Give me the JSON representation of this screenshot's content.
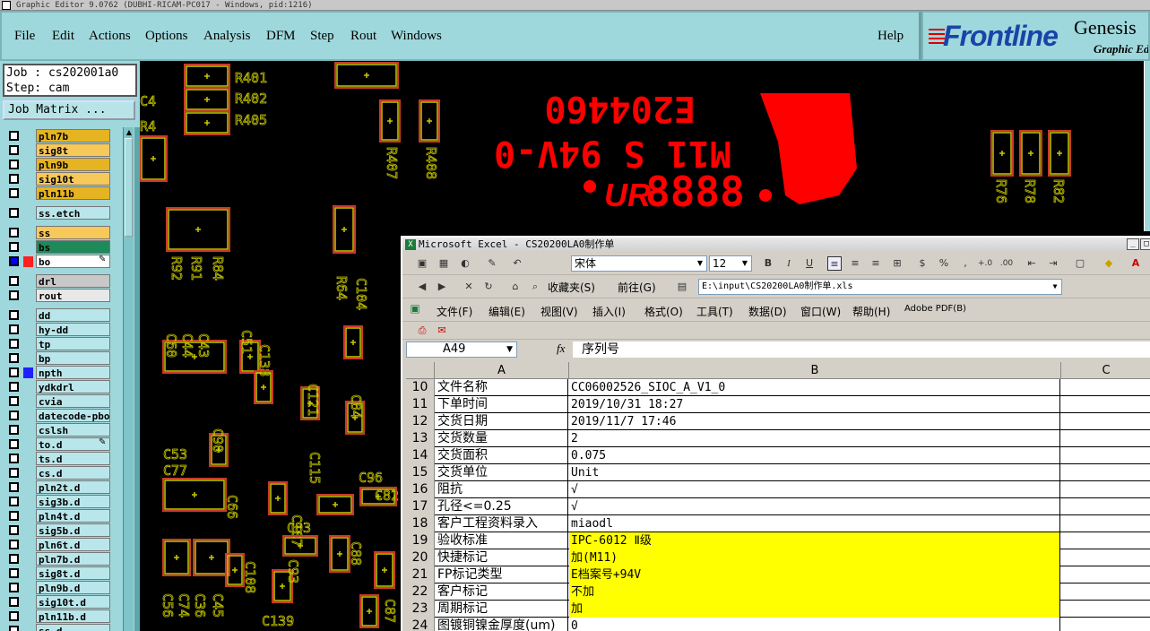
{
  "window": {
    "title": "Graphic Editor 9.0762 (DUBHI-RICAM-PC017 - Windows, pid:1216)"
  },
  "menu": [
    {
      "label": "File"
    },
    {
      "label": "Edit"
    },
    {
      "label": "Actions"
    },
    {
      "label": "Options"
    },
    {
      "label": "Analysis"
    },
    {
      "label": "DFM"
    },
    {
      "label": "Step"
    },
    {
      "label": "Rout"
    },
    {
      "label": "Windows"
    },
    {
      "label": "Help"
    }
  ],
  "logo": {
    "brand": "Frontline",
    "product": "Genesis",
    "subtitle": "Graphic Ed"
  },
  "job": {
    "job_line": "Job : cs202001a0",
    "step_line": "Step: cam",
    "matrix_button": "Job Matrix ..."
  },
  "layers": [
    {
      "name": "pln7b",
      "color": "#e6b422"
    },
    {
      "name": "sig8t",
      "color": "#f7c85a"
    },
    {
      "name": "pln9b",
      "color": "#e6b422"
    },
    {
      "name": "sig10t",
      "color": "#f7c85a"
    },
    {
      "name": "pln11b",
      "color": "#e6b422"
    },
    {
      "name": "ss.etch",
      "color": "#b9e6ea"
    },
    {
      "name": "ss",
      "color": "#f7c85a"
    },
    {
      "name": "bs",
      "color": "#1e8a5a"
    },
    {
      "name": "bo",
      "color": "#ffffff"
    },
    {
      "name": "drl",
      "color": "#c8c8c8"
    },
    {
      "name": "rout",
      "color": "#e8e8e8"
    },
    {
      "name": "dd",
      "color": "#b9e6ea"
    },
    {
      "name": "hy-dd",
      "color": "#b9e6ea"
    },
    {
      "name": "tp",
      "color": "#b9e6ea"
    },
    {
      "name": "bp",
      "color": "#b9e6ea"
    },
    {
      "name": "npth",
      "color": "#b9e6ea"
    },
    {
      "name": "ydkdrl",
      "color": "#b9e6ea"
    },
    {
      "name": "cvia",
      "color": "#b9e6ea"
    },
    {
      "name": "datecode-pbo",
      "color": "#b9e6ea"
    },
    {
      "name": "cslsh",
      "color": "#b9e6ea"
    },
    {
      "name": "to.d",
      "color": "#b9e6ea"
    },
    {
      "name": "ts.d",
      "color": "#b9e6ea"
    },
    {
      "name": "cs.d",
      "color": "#b9e6ea"
    },
    {
      "name": "pln2t.d",
      "color": "#b9e6ea"
    },
    {
      "name": "sig3b.d",
      "color": "#b9e6ea"
    },
    {
      "name": "pln4t.d",
      "color": "#b9e6ea"
    },
    {
      "name": "sig5b.d",
      "color": "#b9e6ea"
    },
    {
      "name": "pln6t.d",
      "color": "#b9e6ea"
    },
    {
      "name": "pln7b.d",
      "color": "#b9e6ea"
    },
    {
      "name": "sig8t.d",
      "color": "#b9e6ea"
    },
    {
      "name": "pln9b.d",
      "color": "#b9e6ea"
    },
    {
      "name": "sig10t.d",
      "color": "#b9e6ea"
    },
    {
      "name": "pln11b.d",
      "color": "#b9e6ea"
    },
    {
      "name": "ss.d",
      "color": "#b9e6ea"
    }
  ],
  "canvas": {
    "labels": [
      "R401",
      "R402",
      "R405",
      "R407",
      "R408",
      "R76",
      "R78",
      "R82",
      "R92",
      "R91",
      "R84",
      "R64",
      "C104",
      "C60",
      "C44",
      "C43",
      "C51",
      "C138",
      "C121",
      "C84",
      "C90",
      "C115",
      "C53",
      "C77",
      "C107",
      "C66",
      "C96",
      "C82",
      "C83",
      "C88",
      "C108",
      "C93",
      "C56",
      "C74",
      "C36",
      "C45",
      "C139",
      "C87",
      "C4",
      "R4"
    ],
    "mark_lines": [
      "E204460",
      "M11 S 94V-0",
      "8888"
    ],
    "ul_logo": "UR"
  },
  "excel": {
    "title": "Microsoft Excel - CS20200LA0制作单",
    "font_name": "宋体",
    "font_size": "12",
    "fav_label": "收藏夹(S)",
    "goto_label": "前往(G)",
    "path": "E:\\input\\CS20200LA0制作单.xls",
    "menus": [
      "文件(F)",
      "编辑(E)",
      "视图(V)",
      "插入(I)",
      "格式(O)",
      "工具(T)",
      "数据(D)",
      "窗口(W)",
      "帮助(H)",
      "Adobe PDF(B)"
    ],
    "name_box": "A49",
    "fx": "fx",
    "formula": "序列号",
    "columns": [
      "A",
      "B",
      "C"
    ],
    "rows": [
      {
        "n": "10",
        "a": "文件名称",
        "b": "CC06002526_SIOC_A_V1_0",
        "hl": false
      },
      {
        "n": "11",
        "a": "下单时间",
        "b": "2019/10/31 18:27",
        "hl": false
      },
      {
        "n": "12",
        "a": "交货日期",
        "b": "2019/11/7 17:46",
        "hl": false
      },
      {
        "n": "13",
        "a": "交货数量",
        "b": "2",
        "hl": false
      },
      {
        "n": "14",
        "a": "交货面积",
        "b": "0.075",
        "hl": false
      },
      {
        "n": "15",
        "a": "交货单位",
        "b": "Unit",
        "hl": false
      },
      {
        "n": "16",
        "a": "阻抗",
        "b": "√",
        "hl": false
      },
      {
        "n": "17",
        "a": "孔径<=0.25",
        "b": "√",
        "hl": false
      },
      {
        "n": "18",
        "a": "客户工程资料录入",
        "b": "miaodl",
        "hl": false
      },
      {
        "n": "19",
        "a": "验收标准",
        "b": "IPC-6012 Ⅱ级",
        "hl": true
      },
      {
        "n": "20",
        "a": "快捷标记",
        "b": "加(M11)",
        "hl": true
      },
      {
        "n": "21",
        "a": "FP标记类型",
        "b": "E档案号+94V",
        "hl": true
      },
      {
        "n": "22",
        "a": "客户标记",
        "b": "不加",
        "hl": true
      },
      {
        "n": "23",
        "a": "周期标记",
        "b": "加",
        "hl": true
      },
      {
        "n": "24",
        "a": "图镀铜镍金厚度(um)",
        "b": "0",
        "hl": false
      }
    ]
  },
  "colors": {
    "panel": "#9fd8dc",
    "highlight": "#ffff00",
    "pcb_red": "#ff0000",
    "pcb_outline": "#c83a2a",
    "pcb_pad": "#c8c800"
  }
}
